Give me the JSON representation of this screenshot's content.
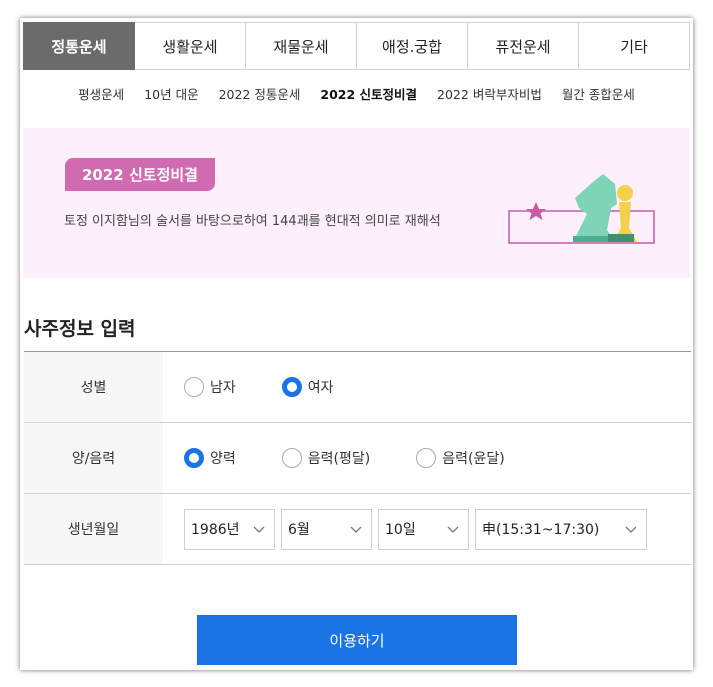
{
  "tabs": [
    {
      "label": "정통운세",
      "active": true
    },
    {
      "label": "생활운세",
      "active": false
    },
    {
      "label": "재물운세",
      "active": false
    },
    {
      "label": "애정.궁합",
      "active": false
    },
    {
      "label": "퓨전운세",
      "active": false
    },
    {
      "label": "기타",
      "active": false
    }
  ],
  "subnav": [
    {
      "label": "평생운세",
      "active": false
    },
    {
      "label": "10년 대운",
      "active": false
    },
    {
      "label": "2022 정통운세",
      "active": false
    },
    {
      "label": "2022 신토정비결",
      "active": true
    },
    {
      "label": "2022 벼락부자비법",
      "active": false
    },
    {
      "label": "월간 종합운세",
      "active": false
    }
  ],
  "banner": {
    "badge": "2022 신토정비결",
    "description": "토정 이지함님의 술서를 바탕으로하여 144괘를 현대적 의미로 재해석",
    "bg_color": "#fdeffb",
    "badge_color": "#d06ab1"
  },
  "section_title": "사주정보 입력",
  "form": {
    "gender": {
      "label": "성별",
      "options": [
        {
          "label": "남자",
          "checked": false
        },
        {
          "label": "여자",
          "checked": true
        }
      ]
    },
    "calendar": {
      "label": "양/음력",
      "options": [
        {
          "label": "양력",
          "checked": true
        },
        {
          "label": "음력(평달)",
          "checked": false
        },
        {
          "label": "음력(윤달)",
          "checked": false
        }
      ]
    },
    "birth": {
      "label": "생년월일",
      "year": "1986년",
      "month": "6월",
      "day": "10일",
      "hour": "申(15:31~17:30)"
    }
  },
  "submit_label": "이용하기",
  "accent_color": "#1b74e4"
}
